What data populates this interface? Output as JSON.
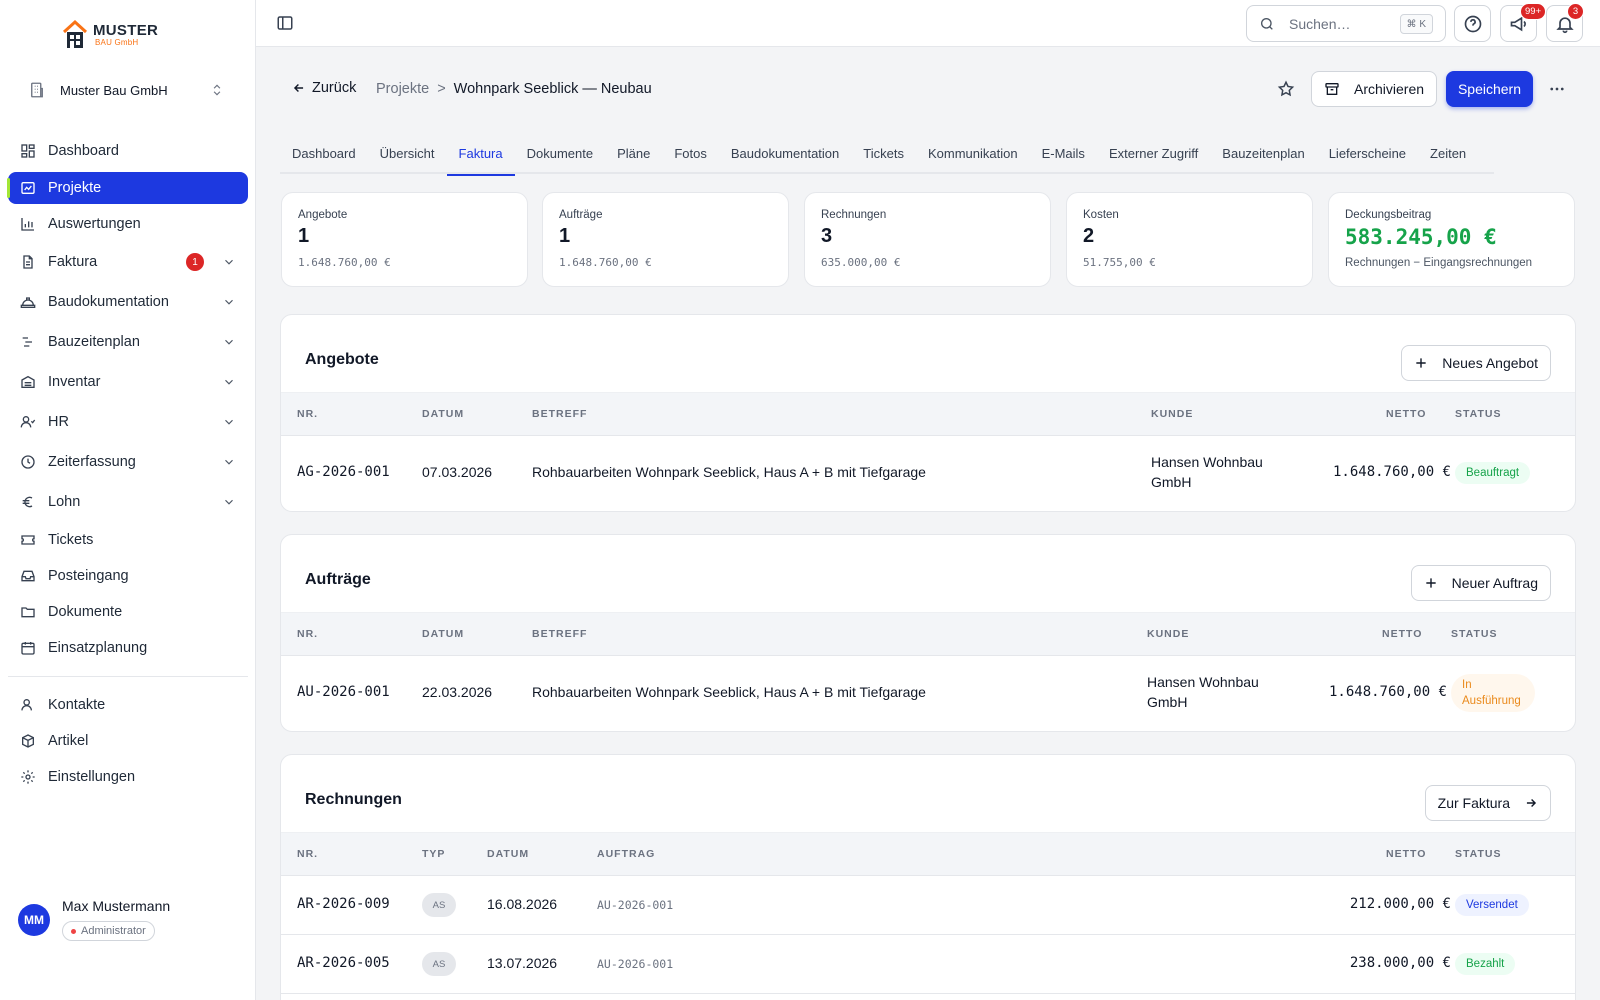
{
  "brand": {
    "name": "MUSTER",
    "sub": "BAU GmbH"
  },
  "org": {
    "name": "Muster Bau GmbH"
  },
  "sidebar": {
    "items": [
      {
        "label": "Dashboard",
        "icon": "grid-icon"
      },
      {
        "label": "Projekte",
        "icon": "projects-icon"
      },
      {
        "label": "Auswertungen",
        "icon": "bar-chart-icon"
      },
      {
        "label": "Faktura",
        "icon": "document-icon",
        "badge": "1"
      },
      {
        "label": "Baudokumentation",
        "icon": "helmet-icon"
      },
      {
        "label": "Bauzeitenplan",
        "icon": "timeline-icon"
      },
      {
        "label": "Inventar",
        "icon": "inventory-icon"
      },
      {
        "label": "HR",
        "icon": "people-icon"
      },
      {
        "label": "Zeiterfassung",
        "icon": "clock-icon"
      },
      {
        "label": "Lohn",
        "icon": "euro-icon"
      },
      {
        "label": "Tickets",
        "icon": "ticket-icon"
      },
      {
        "label": "Posteingang",
        "icon": "inbox-icon"
      },
      {
        "label": "Dokumente",
        "icon": "folder-icon"
      },
      {
        "label": "Einsatzplanung",
        "icon": "calendar-icon"
      },
      {
        "label": "Kontakte",
        "icon": "contacts-icon"
      },
      {
        "label": "Artikel",
        "icon": "package-icon"
      },
      {
        "label": "Einstellungen",
        "icon": "gear-icon"
      }
    ]
  },
  "user": {
    "initials": "MM",
    "name": "Max Mustermann",
    "role": "Administrator"
  },
  "topbar": {
    "search_placeholder": "Suchen…",
    "shortcut": "⌘ K",
    "announcements_count": "99+",
    "notifications_count": "3"
  },
  "header": {
    "back_label": "Zurück",
    "breadcrumb_parent": "Projekte",
    "breadcrumb_sep": ">",
    "breadcrumb_current": "Wohnpark Seeblick — Neubau",
    "archive_label": "Archivieren",
    "save_label": "Speichern"
  },
  "tabs": [
    "Dashboard",
    "Übersicht",
    "Faktura",
    "Dokumente",
    "Pläne",
    "Fotos",
    "Baudokumentation",
    "Tickets",
    "Kommunikation",
    "E-Mails",
    "Externer Zugriff",
    "Bauzeitenplan",
    "Lieferscheine",
    "Zeiten"
  ],
  "active_tab": "Faktura",
  "stats": [
    {
      "label": "Angebote",
      "value": "1",
      "sub": "1.648.760,00 €"
    },
    {
      "label": "Aufträge",
      "value": "1",
      "sub": "1.648.760,00 €"
    },
    {
      "label": "Rechnungen",
      "value": "3",
      "sub": "635.000,00 €"
    },
    {
      "label": "Kosten",
      "value": "2",
      "sub": "51.755,00 €"
    },
    {
      "label": "Deckungsbeitrag",
      "value": "583.245,00 €",
      "sub": "Rechnungen − Eingangsrechnungen"
    }
  ],
  "angebote": {
    "title": "Angebote",
    "button": "Neues Angebot",
    "columns": {
      "nr": "NR.",
      "datum": "DATUM",
      "betreff": "BETREFF",
      "kunde": "KUNDE",
      "netto": "NETTO",
      "status": "STATUS"
    },
    "rows": [
      {
        "nr": "AG-2026-001",
        "datum": "07.03.2026",
        "betreff": "Rohbauarbeiten Wohnpark Seeblick, Haus A + B mit Tiefgarage",
        "kunde_1": "Hansen Wohnbau",
        "kunde_2": "GmbH",
        "netto": "1.648.760,00 €",
        "status": "Beauftragt"
      }
    ]
  },
  "auftraege": {
    "title": "Aufträge",
    "button": "Neuer Auftrag",
    "columns": {
      "nr": "NR.",
      "datum": "DATUM",
      "betreff": "BETREFF",
      "kunde": "KUNDE",
      "netto": "NETTO",
      "status": "STATUS"
    },
    "rows": [
      {
        "nr": "AU-2026-001",
        "datum": "22.03.2026",
        "betreff": "Rohbauarbeiten Wohnpark Seeblick, Haus A + B mit Tiefgarage",
        "kunde_1": "Hansen Wohnbau",
        "kunde_2": "GmbH",
        "netto": "1.648.760,00 €",
        "status_1": "In",
        "status_2": "Ausführung"
      }
    ]
  },
  "rechnungen": {
    "title": "Rechnungen",
    "button": "Zur Faktura",
    "columns": {
      "nr": "NR.",
      "typ": "TYP",
      "datum": "DATUM",
      "auftrag": "AUFTRAG",
      "netto": "NETTO",
      "status": "STATUS"
    },
    "rows": [
      {
        "nr": "AR-2026-009",
        "typ": "AS",
        "datum": "16.08.2026",
        "auftrag": "AU-2026-001",
        "netto": "212.000,00 €",
        "status": "Versendet"
      },
      {
        "nr": "AR-2026-005",
        "typ": "AS",
        "datum": "13.07.2026",
        "auftrag": "AU-2026-001",
        "netto": "238.000,00 €",
        "status": "Bezahlt"
      }
    ]
  },
  "colors": {
    "accent": "#1d39e0",
    "success": "#16a34a",
    "warning": "#ea8a1c",
    "danger": "#dc2626"
  }
}
